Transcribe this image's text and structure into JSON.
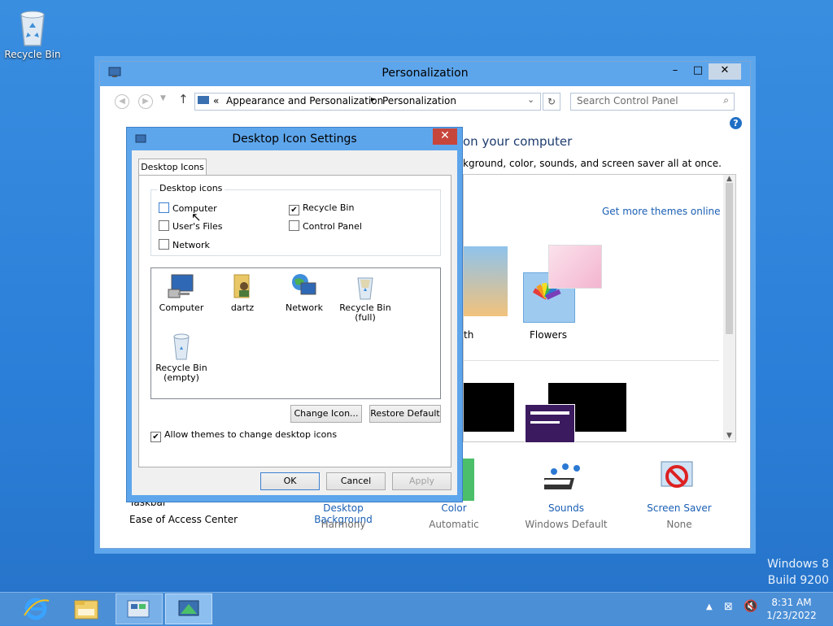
{
  "desktop": {
    "recycle_label": "Recycle Bin",
    "os_name": "Windows 8",
    "os_build": "Build 9200"
  },
  "personalization": {
    "title": "Personalization",
    "address": {
      "crumb_sep": "«",
      "crumb1": "Appearance and Personalization",
      "crumb2": "Personalization"
    },
    "search_placeholder": "Search Control Panel",
    "heading": "on your computer",
    "subtext": "kground, color, sounds, and screen saver all at once.",
    "get_more_themes": "Get more themes online",
    "theme_label_partial": "th",
    "theme_label_flowers": "Flowers",
    "side_link_taskbar": "Taskbar",
    "side_link_ease": "Ease of Access Center",
    "bottom": [
      {
        "label": "Desktop Background",
        "value": "Harmony"
      },
      {
        "label": "Color",
        "value": "Automatic"
      },
      {
        "label": "Sounds",
        "value": "Windows Default"
      },
      {
        "label": "Screen Saver",
        "value": "None"
      }
    ]
  },
  "dialog": {
    "title": "Desktop Icon Settings",
    "tab": "Desktop Icons",
    "group_label": "Desktop icons",
    "checkboxes": [
      {
        "label": "Computer",
        "checked": false
      },
      {
        "label": "User's Files",
        "checked": false
      },
      {
        "label": "Network",
        "checked": false
      },
      {
        "label": "Recycle Bin",
        "checked": true
      },
      {
        "label": "Control Panel",
        "checked": false
      }
    ],
    "icons": [
      {
        "label": "Computer"
      },
      {
        "label": "dartz"
      },
      {
        "label": "Network"
      },
      {
        "label": "Recycle Bin (full)"
      },
      {
        "label": "Recycle Bin (empty)"
      }
    ],
    "change_icon": "Change Icon...",
    "restore_default": "Restore Default",
    "allow_themes": "Allow themes to change desktop icons",
    "allow_themes_checked": true,
    "ok": "OK",
    "cancel": "Cancel",
    "apply": "Apply"
  },
  "taskbar": {
    "time": "8:31 AM",
    "date": "1/23/2022"
  },
  "colors": {
    "accent": "#5ea6ec",
    "link": "#1a5fb4",
    "desktop": "#2b7fd8"
  }
}
